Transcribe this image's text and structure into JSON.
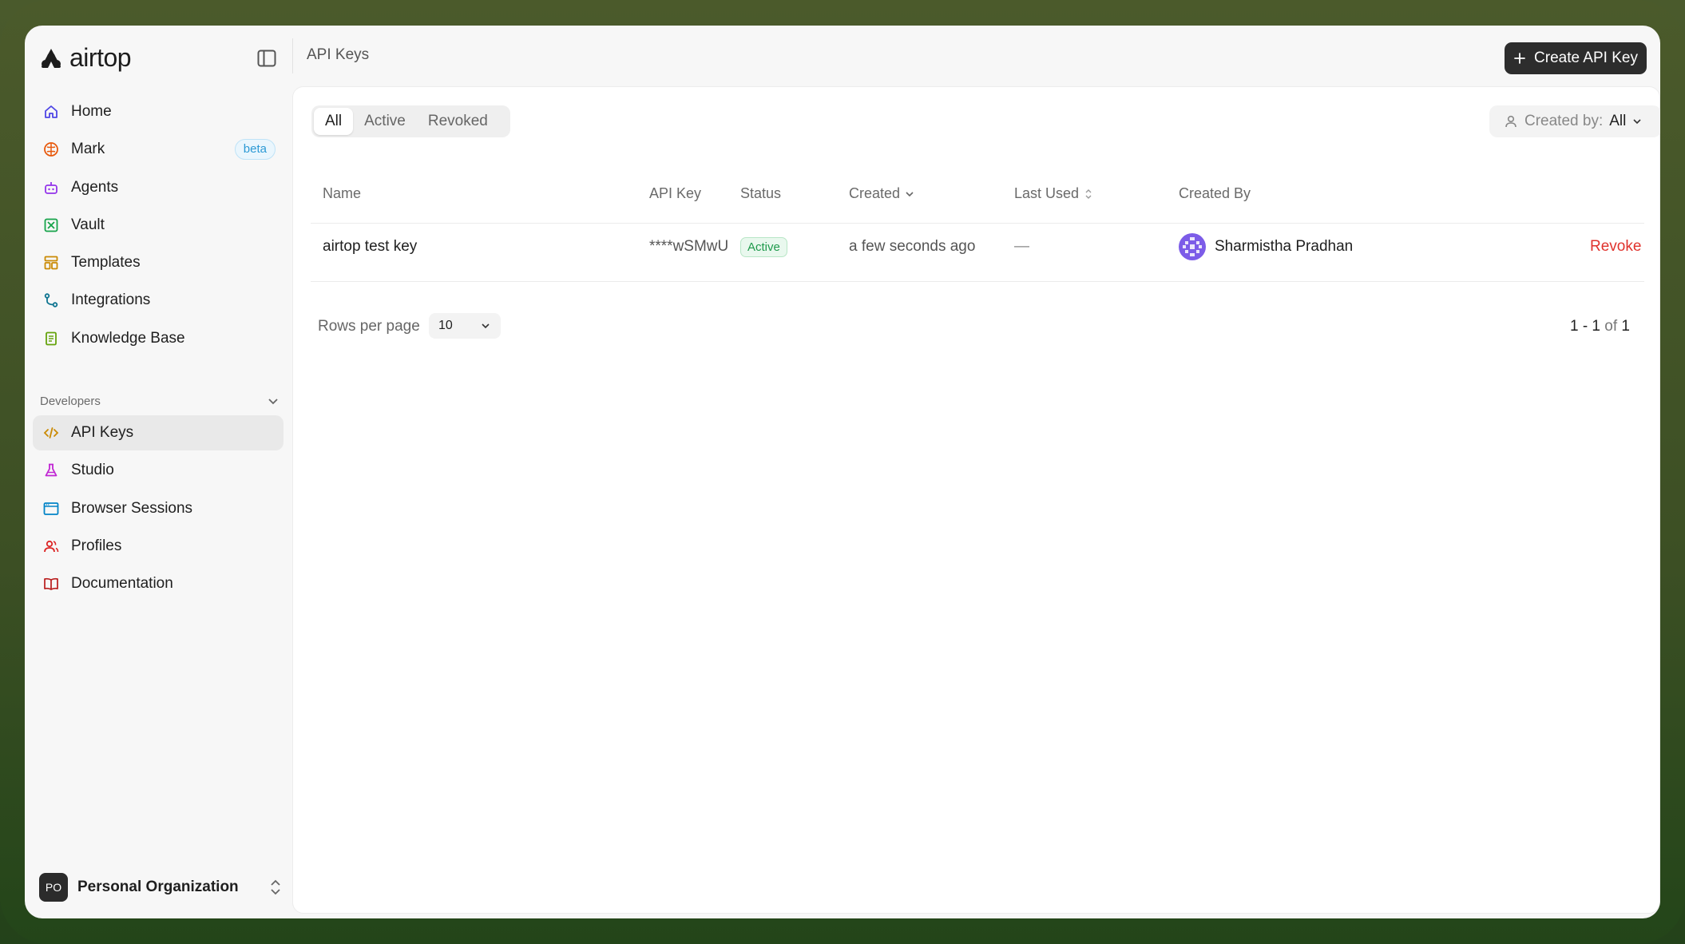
{
  "app": {
    "logo_text": "airtop"
  },
  "sidebar": {
    "items": [
      {
        "label": "Home",
        "icon": "home-icon",
        "color": "#4f46e5"
      },
      {
        "label": "Mark",
        "icon": "brain-icon",
        "color": "#e8590c",
        "badge": "beta"
      },
      {
        "label": "Agents",
        "icon": "robot-icon",
        "color": "#9333ea"
      },
      {
        "label": "Vault",
        "icon": "vault-icon",
        "color": "#16a34a"
      },
      {
        "label": "Templates",
        "icon": "templates-icon",
        "color": "#ca8a04"
      },
      {
        "label": "Integrations",
        "icon": "integrations-icon",
        "color": "#0e7490"
      },
      {
        "label": "Knowledge Base",
        "icon": "book-icon",
        "color": "#65a30d"
      }
    ],
    "section_label": "Developers",
    "dev_items": [
      {
        "label": "API Keys",
        "icon": "code-icon",
        "color": "#ca8a04",
        "active": true
      },
      {
        "label": "Studio",
        "icon": "flask-icon",
        "color": "#c026d3"
      },
      {
        "label": "Browser Sessions",
        "icon": "browser-icon",
        "color": "#0284c7"
      },
      {
        "label": "Profiles",
        "icon": "users-icon",
        "color": "#dc2626"
      },
      {
        "label": "Documentation",
        "icon": "open-book-icon",
        "color": "#b91c1c"
      }
    ],
    "org": {
      "initials": "PO",
      "name": "Personal Organization"
    }
  },
  "header": {
    "title": "API Keys",
    "create_button": "Create API Key"
  },
  "filters": {
    "tabs": [
      "All",
      "Active",
      "Revoked"
    ],
    "selected_tab": "All",
    "created_by_label": "Created by:",
    "created_by_value": "All"
  },
  "table": {
    "columns": [
      "Name",
      "API Key",
      "Status",
      "Created",
      "Last Used",
      "Created By"
    ],
    "rows": [
      {
        "name": "airtop test key",
        "api_key": "****wSMwU",
        "status": "Active",
        "created": "a few seconds ago",
        "last_used": "—",
        "created_by": "Sharmistha Pradhan",
        "action": "Revoke"
      }
    ]
  },
  "pagination": {
    "rows_per_page_label": "Rows per page",
    "rows_per_page_value": "10",
    "range": "1 - 1",
    "of_label": "of",
    "total": "1"
  }
}
